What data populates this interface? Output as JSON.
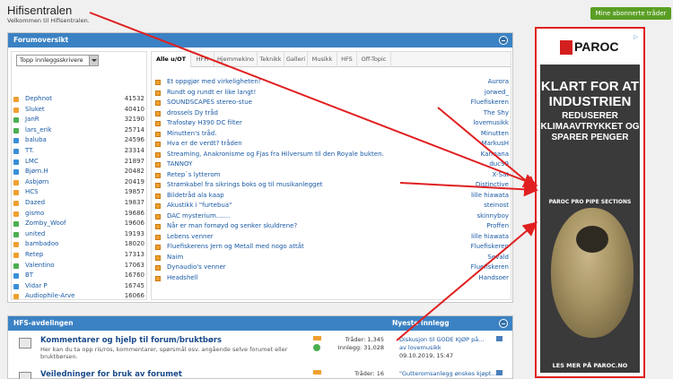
{
  "header": {
    "site_title": "Hifisentralen",
    "welcome": "Velkommen til Hifisentralen.",
    "subscribed_threads_button": "Mine abonnerte tråder"
  },
  "forum_overview": {
    "title": "Forumoversikt",
    "writers_select": "Topp innleggsskrivere",
    "writers": [
      {
        "name": "Dephnot",
        "count": "41532",
        "color": "#f0a030"
      },
      {
        "name": "Sluket",
        "count": "40410",
        "color": "#f0a030"
      },
      {
        "name": "JanR",
        "count": "32190",
        "color": "#4caf50"
      },
      {
        "name": "lars_erik",
        "count": "25714",
        "color": "#4caf50"
      },
      {
        "name": "baluba",
        "count": "24596",
        "color": "#3a8fd8"
      },
      {
        "name": "TT.",
        "count": "23314",
        "color": "#3a8fd8"
      },
      {
        "name": "LMC",
        "count": "21897",
        "color": "#3a8fd8"
      },
      {
        "name": "Bjørn.H",
        "count": "20482",
        "color": "#3a8fd8"
      },
      {
        "name": "Asbjørn",
        "count": "20419",
        "color": "#f0a030"
      },
      {
        "name": "HCS",
        "count": "19857",
        "color": "#f0a030"
      },
      {
        "name": "Dazed",
        "count": "19837",
        "color": "#f0a030"
      },
      {
        "name": "gismo",
        "count": "19686",
        "color": "#f0a030"
      },
      {
        "name": "Zomby_Woof",
        "count": "19606",
        "color": "#4caf50"
      },
      {
        "name": "united",
        "count": "19193",
        "color": "#4caf50"
      },
      {
        "name": "bambadoo",
        "count": "18020",
        "color": "#f0a030"
      },
      {
        "name": "Retep",
        "count": "17313",
        "color": "#f0a030"
      },
      {
        "name": "Valentino",
        "count": "17063",
        "color": "#4caf50"
      },
      {
        "name": "BT",
        "count": "16760",
        "color": "#3a8fd8"
      },
      {
        "name": "Vidar P",
        "count": "16745",
        "color": "#3a8fd8"
      },
      {
        "name": "Audiophile-Arve",
        "count": "16066",
        "color": "#f0a030"
      }
    ],
    "tabs": [
      "Alle u/OT",
      "HFH",
      "Hjemmekino",
      "Teknikk",
      "Galleri",
      "Musikk",
      "HFS",
      "Off-Topic"
    ],
    "topics": [
      {
        "title": "Et oppgjør med virkeligheten!",
        "user": "Aurora"
      },
      {
        "title": "Rundt og rundt er like langt!",
        "user": "jorwed_"
      },
      {
        "title": "SOUNDSCAPES stereo-stue",
        "user": "Fluefiskeren"
      },
      {
        "title": "drossels Dy tråd",
        "user": "The Shy"
      },
      {
        "title": "Trafostøy H390 DC filter",
        "user": "lovemusikk"
      },
      {
        "title": "Minutten's tråd.",
        "user": "Minutten"
      },
      {
        "title": "Hva er de verdt? tråden",
        "user": "MarkusH"
      },
      {
        "title": "Streaming, Anakronisme og Fjas fra Hilversum til den Royale bukten.",
        "user": "Karmana"
      },
      {
        "title": "TANNOY",
        "user": "duc99"
      },
      {
        "title": "Retep`s lytterom",
        "user": "X-Sat"
      },
      {
        "title": "Strømkabel fra sikrings boks og til musikanlegget",
        "user": "Distinctive"
      },
      {
        "title": "Bildetråd ala kaap",
        "user": "lille hiawata"
      },
      {
        "title": "Akustikk i \"furtebua\"",
        "user": "steinost"
      },
      {
        "title": "DAC mysterium.......",
        "user": "skinnyboy"
      },
      {
        "title": "Når er man fornøyd og senker skuldrene?",
        "user": "Proffen"
      },
      {
        "title": "Lebens venner",
        "user": "lille hiawata"
      },
      {
        "title": "Fluefiskerens Jern og Metall med nogo attåt",
        "user": "Fluefiskeren"
      },
      {
        "title": "Naim",
        "user": "Sevald"
      },
      {
        "title": "Dynaudio's venner",
        "user": "Fluefiskeren"
      },
      {
        "title": "Headshell",
        "user": "Handsoer"
      }
    ]
  },
  "hfs_section": {
    "title": "HFS-avdelingen",
    "newest_header": "Nyeste innlegg",
    "subforums": [
      {
        "title": "Kommentarer og hjelp til forum/bruktbørs",
        "description": "Her kan du ta opp ris/ros, kommentarer, spørsmål osv. angående selve forumet eller bruktbørsen.",
        "threads": "Tråder: 1,345",
        "posts": "Innlegg: 31,028",
        "last_title": "Diskusjon til GODE KJØP på...",
        "last_by": "av lovemusikk",
        "last_date": "09.10.2019, 15:47"
      },
      {
        "title": "Veiledninger for bruk av forumet",
        "description": "",
        "threads": "Tråder: 16",
        "posts": "",
        "last_title": "\"Gutteromsanlegg ønskes kjøpt...",
        "last_by": "",
        "last_date": ""
      }
    ]
  },
  "ad": {
    "adchoices": "▷",
    "brand": "PAROC",
    "headline": "KLART FOR AT INDUSTRIEN",
    "subhead": "REDUSERER KLIMAAVTRYKKET OG SPARER PENGER",
    "product": "PAROC PRO PIPE SECTIONS",
    "cta": "LES MER PÅ PAROC.NO"
  },
  "colors": {
    "header_blue": "#3b82c4",
    "link_blue": "#1a5aa5",
    "green_button": "#5a9e24",
    "annotation_red": "#e02020"
  }
}
